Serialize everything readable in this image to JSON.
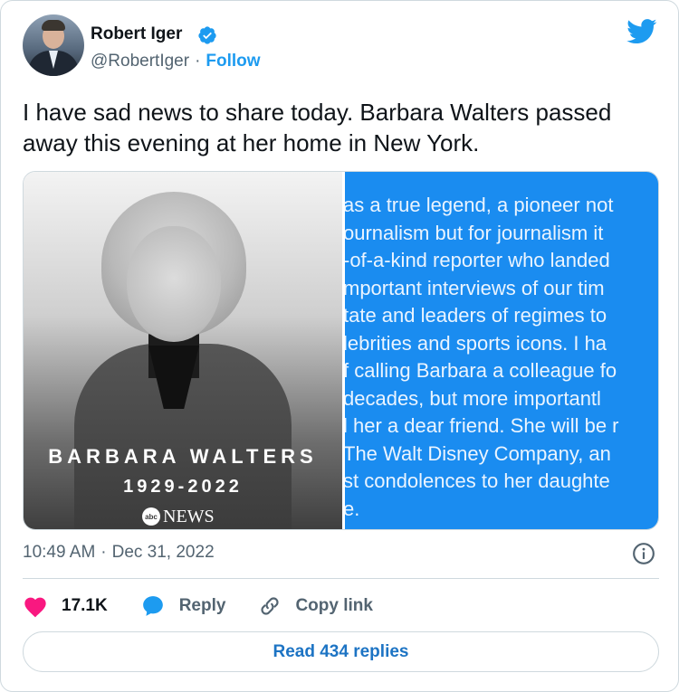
{
  "author": {
    "display_name": "Robert Iger",
    "handle": "@RobertIger",
    "follow_label": "Follow"
  },
  "tweet": {
    "text": "I have sad news to share today. Barbara Walters passed away this evening at her home in New York.",
    "timestamp_time": "10:49 AM",
    "timestamp_date": "Dec 31, 2022"
  },
  "media": {
    "tribute": {
      "name": "BARBARA WALTERS",
      "years": "1929-2022",
      "logo_mark": "abc",
      "logo_word": "NEWS"
    },
    "statement_lines": [
      "as a true legend, a pioneer not",
      "ournalism but for journalism it",
      "-of-a-kind reporter who landed",
      "mportant interviews of our tim",
      "tate and leaders of regimes to",
      "lebrities and sports icons. I ha",
      "f calling Barbara a colleague fo",
      " decades, but more importantl",
      "l her a dear friend. She will be r",
      " The Walt Disney Company, an",
      "st condolences to her daughte",
      "e."
    ]
  },
  "actions": {
    "likes_count": "17.1K",
    "reply_label": "Reply",
    "copy_link_label": "Copy link",
    "read_replies_label": "Read 434 replies"
  },
  "icons": {
    "verified": "verified-badge-icon",
    "brand": "twitter-bird-icon",
    "info": "info-icon",
    "like": "heart-icon",
    "reply": "speech-bubble-icon",
    "copy": "link-icon"
  },
  "colors": {
    "accent": "#1d9bf0",
    "like": "#f91880",
    "text": "#0f1419",
    "muted": "#536471",
    "border": "#cfd9de",
    "statement_bg": "#1a8cf0"
  }
}
